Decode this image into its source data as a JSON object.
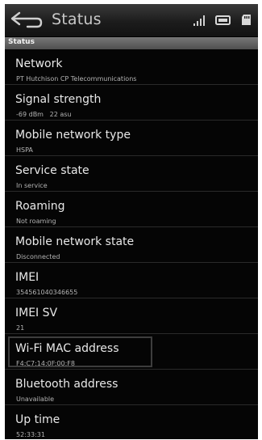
{
  "header": {
    "title": "Status",
    "subtitle": "Status",
    "icons": [
      "back-arrow-icon",
      "signal-icon",
      "battery-icon",
      "sd-card-icon"
    ]
  },
  "items": [
    {
      "label": "Network",
      "value": "PT Hutchison CP Telecommunications"
    },
    {
      "label": "Signal strength",
      "value": "-69 dBm   22 asu"
    },
    {
      "label": "Mobile network type",
      "value": "HSPA"
    },
    {
      "label": "Service state",
      "value": "In service"
    },
    {
      "label": "Roaming",
      "value": "Not roaming"
    },
    {
      "label": "Mobile network state",
      "value": "Disconnected"
    },
    {
      "label": "IMEI",
      "value": "354561040346655"
    },
    {
      "label": "IMEI SV",
      "value": "21"
    },
    {
      "label": "Wi-Fi MAC address",
      "value": "F4:C7:14:0F:00:F8",
      "focused": true
    },
    {
      "label": "Bluetooth address",
      "value": "Unavailable"
    },
    {
      "label": "Up time",
      "value": "52:33:31"
    }
  ]
}
